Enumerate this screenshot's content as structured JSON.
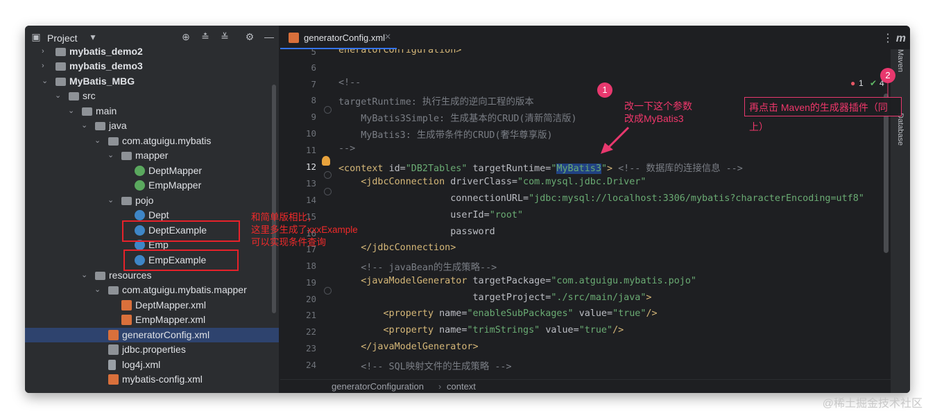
{
  "project": {
    "header": "Project",
    "tree": [
      {
        "label": "mybatis_demo2",
        "bold": true
      },
      {
        "label": "mybatis_demo3",
        "bold": true
      },
      {
        "label": "MyBatis_MBG",
        "bold": true
      },
      {
        "label": "src"
      },
      {
        "label": "main"
      },
      {
        "label": "java"
      },
      {
        "label": "com.atguigu.mybatis"
      },
      {
        "label": "mapper"
      },
      {
        "label": "DeptMapper"
      },
      {
        "label": "EmpMapper"
      },
      {
        "label": "pojo"
      },
      {
        "label": "Dept"
      },
      {
        "label": "DeptExample"
      },
      {
        "label": "Emp"
      },
      {
        "label": "EmpExample"
      },
      {
        "label": "resources"
      },
      {
        "label": "com.atguigu.mybatis.mapper"
      },
      {
        "label": "DeptMapper.xml"
      },
      {
        "label": "EmpMapper.xml"
      },
      {
        "label": "generatorConfig.xml"
      },
      {
        "label": "jdbc.properties"
      },
      {
        "label": "log4j.xml"
      },
      {
        "label": "mybatis-config.xml"
      }
    ],
    "annotation": [
      "和简单版相比，",
      "这里多生成了xxxExample",
      "可以实现条件查询"
    ]
  },
  "editor": {
    "tab": "generatorConfig.xml",
    "line_numbers": [
      "5",
      "6",
      "7",
      "8",
      "9",
      "10",
      "11",
      "12",
      "13",
      "14",
      "15",
      "16",
      "17",
      "18",
      "19",
      "20",
      "21",
      "22",
      "23",
      "24"
    ],
    "errors": "1",
    "warnings": "4",
    "status": [
      "generatorConfiguration",
      "context"
    ]
  },
  "annotations": {
    "badge1": "1",
    "badge2": "2",
    "note1": [
      "改一下这个参数",
      "改成MyBatis3"
    ],
    "note2": "再点击 Maven的生成器插件（同上）"
  },
  "sidebar_right": [
    "Maven",
    "Database"
  ],
  "watermark": "@稀土掘金技术社区"
}
